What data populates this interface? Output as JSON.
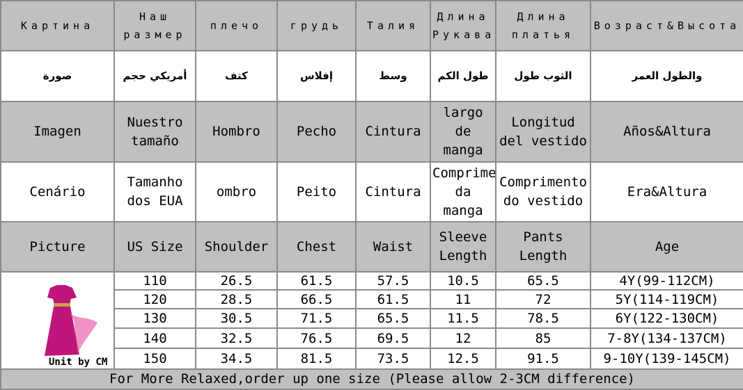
{
  "header_rows": [
    {
      "lang": "ru",
      "cells": [
        "Картина",
        "Наш размер",
        "плечо",
        "грудь",
        "Талия",
        "Длина Рукава",
        "Длина платья",
        "Возраст&Высота"
      ]
    },
    {
      "lang": "ar",
      "cells": [
        "صورة",
        "أمريكي حجم",
        "كتف",
        "إفلاس",
        "وسط",
        "طول الكم",
        "الثوب طول",
        "والطول العمر"
      ]
    },
    {
      "lang": "es",
      "cells": [
        "Imagen",
        "Nuestro tamaño",
        "Hombro",
        "Pecho",
        "Cintura",
        "largo de manga",
        "Longitud del vestido",
        "Años&Altura"
      ]
    },
    {
      "lang": "pt",
      "cells": [
        "Cenário",
        "Tamanho dos EUA",
        "ombro",
        "Peito",
        "Cintura",
        "Comprimento da manga",
        "Comprimento do vestido",
        "Era&Altura"
      ]
    },
    {
      "lang": "en",
      "cells": [
        "Picture",
        "US Size",
        "Shoulder",
        "Chest",
        "Waist",
        "Sleeve Length",
        "Pants Length",
        "Age"
      ]
    }
  ],
  "unit_label": "Unit by CM",
  "dress_color": "#c0157a",
  "rows": [
    [
      "110",
      "26.5",
      "61.5",
      "57.5",
      "10.5",
      "65.5",
      "4Y(99-112CM)"
    ],
    [
      "120",
      "28.5",
      "66.5",
      "61.5",
      "11",
      "72",
      "5Y(114-119CM)"
    ],
    [
      "130",
      "30.5",
      "71.5",
      "65.5",
      "11.5",
      "78.5",
      "6Y(122-130CM)"
    ],
    [
      "140",
      "32.5",
      "76.5",
      "69.5",
      "12",
      "85",
      "7-8Y(134-137CM)"
    ],
    [
      "150",
      "34.5",
      "81.5",
      "73.5",
      "12.5",
      "91.5",
      "9-10Y(139-145CM)"
    ]
  ],
  "footer": "For More Relaxed,order up one size (Please allow 2-3CM difference)"
}
